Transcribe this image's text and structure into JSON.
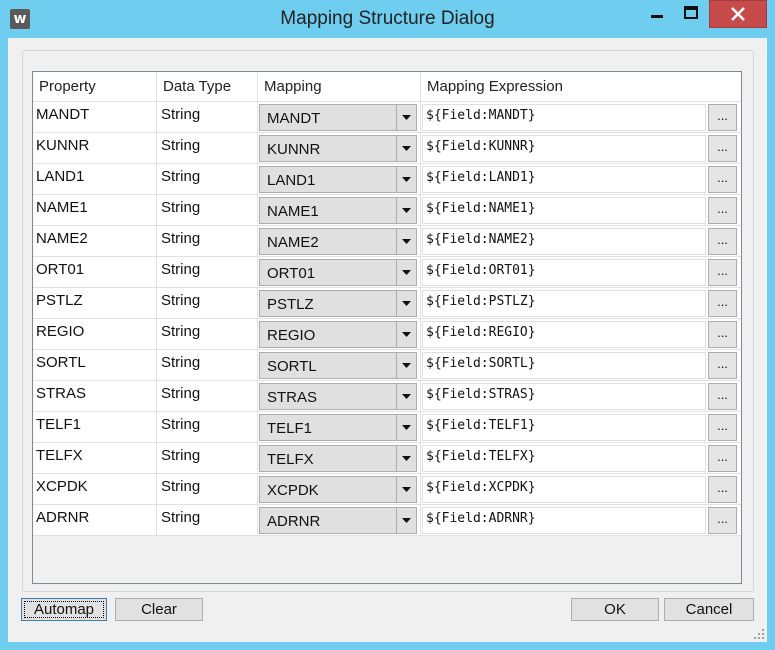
{
  "window": {
    "title": "Mapping Structure Dialog",
    "icon_letter": "w",
    "controls": [
      "minimize-icon",
      "maximize-icon",
      "close-icon"
    ]
  },
  "grid": {
    "columns": [
      "Property",
      "Data Type",
      "Mapping",
      "Mapping Expression"
    ],
    "rows": [
      {
        "property": "MANDT",
        "type": "String",
        "mapping": "MANDT",
        "expression": "${Field:MANDT}",
        "ellipsis": "..."
      },
      {
        "property": "KUNNR",
        "type": "String",
        "mapping": "KUNNR",
        "expression": "${Field:KUNNR}",
        "ellipsis": "..."
      },
      {
        "property": "LAND1",
        "type": "String",
        "mapping": "LAND1",
        "expression": "${Field:LAND1}",
        "ellipsis": "..."
      },
      {
        "property": "NAME1",
        "type": "String",
        "mapping": "NAME1",
        "expression": "${Field:NAME1}",
        "ellipsis": "..."
      },
      {
        "property": "NAME2",
        "type": "String",
        "mapping": "NAME2",
        "expression": "${Field:NAME2}",
        "ellipsis": "..."
      },
      {
        "property": "ORT01",
        "type": "String",
        "mapping": "ORT01",
        "expression": "${Field:ORT01}",
        "ellipsis": "..."
      },
      {
        "property": "PSTLZ",
        "type": "String",
        "mapping": "PSTLZ",
        "expression": "${Field:PSTLZ}",
        "ellipsis": "..."
      },
      {
        "property": "REGIO",
        "type": "String",
        "mapping": "REGIO",
        "expression": "${Field:REGIO}",
        "ellipsis": "..."
      },
      {
        "property": "SORTL",
        "type": "String",
        "mapping": "SORTL",
        "expression": "${Field:SORTL}",
        "ellipsis": "..."
      },
      {
        "property": "STRAS",
        "type": "String",
        "mapping": "STRAS",
        "expression": "${Field:STRAS}",
        "ellipsis": "..."
      },
      {
        "property": "TELF1",
        "type": "String",
        "mapping": "TELF1",
        "expression": "${Field:TELF1}",
        "ellipsis": "..."
      },
      {
        "property": "TELFX",
        "type": "String",
        "mapping": "TELFX",
        "expression": "${Field:TELFX}",
        "ellipsis": "..."
      },
      {
        "property": "XCPDK",
        "type": "String",
        "mapping": "XCPDK",
        "expression": "${Field:XCPDK}",
        "ellipsis": "..."
      },
      {
        "property": "ADRNR",
        "type": "String",
        "mapping": "ADRNR",
        "expression": "${Field:ADRNR}",
        "ellipsis": "..."
      }
    ]
  },
  "buttons": {
    "automap": "Automap",
    "clear": "Clear",
    "ok": "OK",
    "cancel": "Cancel"
  },
  "colors": {
    "title_bar": "#6fcdf0",
    "close_button": "#c74b4b",
    "dialog_bg": "#f0f0f0"
  }
}
